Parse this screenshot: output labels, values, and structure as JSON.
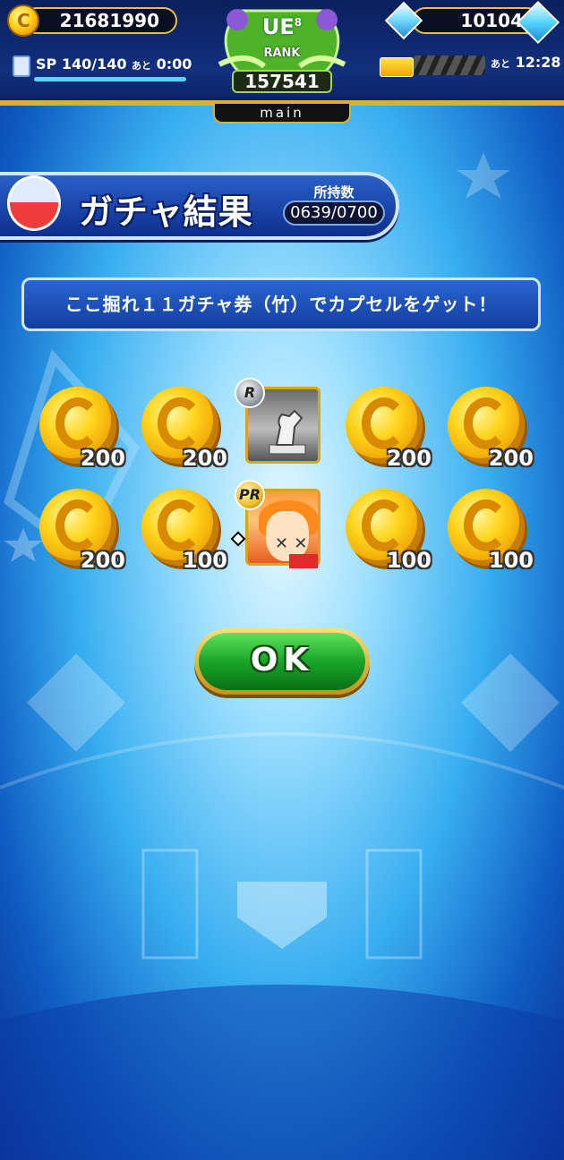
{
  "header": {
    "coins": "21681990",
    "gems": "10104",
    "sp_label": "SP",
    "sp_value": "140/140",
    "sp_until_label": "あと",
    "sp_timer": "0:00",
    "sp_fill": 1.0,
    "rank_label": "RANK",
    "rank_grade": "UE",
    "rank_tier": "8",
    "rank_points": "157541",
    "tab_label": "main",
    "stamina_until_label": "あと",
    "stamina_timer": "12:28"
  },
  "banner": {
    "title": "ガチャ結果",
    "owned_label": "所持数",
    "owned_value": "0639/0700"
  },
  "message": "ここ掘れ１１ガチャ券（竹）でカプセルをゲット！",
  "rewards": [
    {
      "type": "coin",
      "amount": "200"
    },
    {
      "type": "coin",
      "amount": "200"
    },
    {
      "type": "item",
      "rarity": "R"
    },
    {
      "type": "coin",
      "amount": "200"
    },
    {
      "type": "coin",
      "amount": "200"
    },
    {
      "type": "coin",
      "amount": "200"
    },
    {
      "type": "coin",
      "amount": "100"
    },
    {
      "type": "character",
      "rarity": "PR"
    },
    {
      "type": "coin",
      "amount": "100"
    },
    {
      "type": "coin",
      "amount": "100"
    }
  ],
  "ok_button": "OK",
  "colors": {
    "accent_gold": "#d9b12a",
    "ok_green": "#19a628",
    "banner_blue": "#123f9e"
  }
}
